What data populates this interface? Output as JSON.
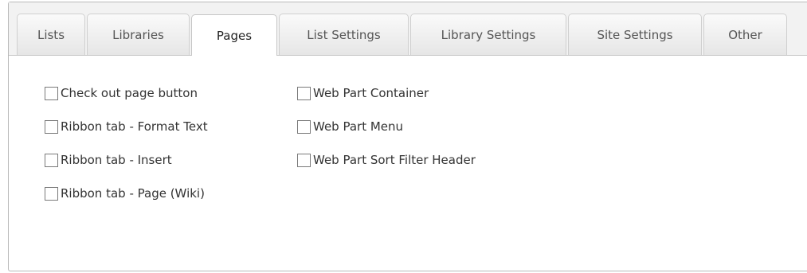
{
  "tabs": [
    {
      "label": "Lists"
    },
    {
      "label": "Libraries"
    },
    {
      "label": "Pages",
      "active": true
    },
    {
      "label": "List Settings"
    },
    {
      "label": "Library Settings"
    },
    {
      "label": "Site Settings"
    },
    {
      "label": "Other"
    }
  ],
  "options": {
    "left": [
      {
        "label": "Check out page button",
        "checked": false
      },
      {
        "label": "Ribbon tab - Format Text",
        "checked": false
      },
      {
        "label": "Ribbon tab - Insert",
        "checked": false
      },
      {
        "label": "Ribbon tab - Page (Wiki)",
        "checked": false
      }
    ],
    "right": [
      {
        "label": "Web Part Container",
        "checked": false
      },
      {
        "label": "Web Part Menu",
        "checked": false
      },
      {
        "label": "Web Part Sort Filter Header",
        "checked": false
      }
    ]
  }
}
